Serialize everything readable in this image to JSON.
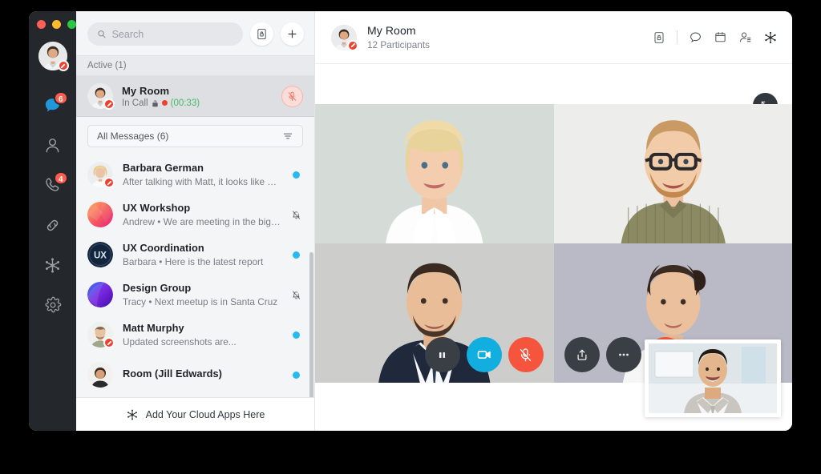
{
  "window": {
    "traffic_lights": [
      "close",
      "minimize",
      "maximize"
    ]
  },
  "nav_rail": {
    "avatar_name": "self-avatar",
    "items": [
      {
        "id": "messages",
        "icon": "chat-bubble-icon",
        "badge": "6",
        "active": true
      },
      {
        "id": "contacts",
        "icon": "person-icon",
        "badge": "",
        "active": false
      },
      {
        "id": "calls",
        "icon": "phone-icon",
        "badge": "4",
        "active": false
      },
      {
        "id": "links",
        "icon": "link-chain-icon",
        "badge": "",
        "active": false
      },
      {
        "id": "apps",
        "icon": "apps-hub-icon",
        "badge": "",
        "active": false
      },
      {
        "id": "settings",
        "icon": "gear-icon",
        "badge": "",
        "active": false
      }
    ]
  },
  "search": {
    "placeholder": "Search",
    "value": "",
    "secure_button": "secure-lock-button",
    "add_button": "+"
  },
  "active_section": {
    "header": "Active (1)",
    "room": {
      "title": "My Room",
      "status": "In Call",
      "lock_icon": "lock-icon",
      "recording_icon": "recording-dot",
      "timer": "(00:33)",
      "mute_button": "mic-muted-button"
    }
  },
  "filter": {
    "label": "All Messages (6)",
    "icon": "filter-lines-icon"
  },
  "messages": [
    {
      "name": "Barbara German",
      "preview": "After talking with Matt, it looks like we...",
      "flag": "unread",
      "avatar": "photo-woman-blonde",
      "pencil": true
    },
    {
      "name": "UX Workshop",
      "preview": "Andrew • We are meeting in the big conf...",
      "flag": "muted",
      "avatar": "gradient-orange",
      "pencil": false
    },
    {
      "name": "UX Coordination",
      "preview": "Barbara • Here is the latest report",
      "flag": "unread",
      "avatar": "initials-ux",
      "avatar_text": "UX",
      "pencil": false
    },
    {
      "name": "Design Group",
      "preview": "Tracy • Next meetup is in Santa Cruz",
      "flag": "muted",
      "avatar": "gradient-purple",
      "pencil": false
    },
    {
      "name": "Matt Murphy",
      "preview": "Updated screenshots are...",
      "flag": "unread",
      "avatar": "photo-man-beard",
      "pencil": true
    },
    {
      "name": "Room (Jill Edwards)",
      "preview": "",
      "flag": "unread",
      "avatar": "photo-woman-dark",
      "pencil": false
    }
  ],
  "cloud_apps": {
    "label": "Add Your Cloud Apps Here",
    "icon": "apps-hub-icon"
  },
  "main_header": {
    "title": "My Room",
    "subtitle": "12 Participants",
    "icons": [
      "secure-lock-icon",
      "chat-bubble-icon",
      "whiteboard-icon",
      "participants-icon",
      "apps-hub-icon"
    ]
  },
  "video": {
    "expand_button": "expand-icon",
    "popout_button": "popout-icon",
    "tiles": [
      {
        "participant": "woman-blonde",
        "bg": "#d5dcd8"
      },
      {
        "participant": "man-glasses-beard",
        "bg": "#ededec"
      },
      {
        "participant": "man-suit",
        "bg": "#cdcecb"
      },
      {
        "participant": "woman-dark-hair",
        "bg": "#b9bac6"
      }
    ],
    "self_view": "self-video-preview"
  },
  "call_controls": [
    {
      "id": "pause",
      "icon": "pause-icon",
      "style": "dark"
    },
    {
      "id": "video",
      "icon": "video-camera-icon",
      "style": "blue"
    },
    {
      "id": "mute",
      "icon": "mic-muted-icon",
      "style": "red"
    },
    {
      "id": "share",
      "icon": "share-upload-icon",
      "style": "dark"
    },
    {
      "id": "more",
      "icon": "more-dots-icon",
      "style": "dark"
    },
    {
      "id": "end",
      "icon": "close-x-icon",
      "style": "red"
    }
  ],
  "colors": {
    "accent_blue": "#13aee0",
    "accent_red": "#f5553d",
    "unread_dot": "#24bbf0",
    "timer_green": "#43b969",
    "rail_bg": "#24282c",
    "panel_bg": "#f4f5f7"
  }
}
